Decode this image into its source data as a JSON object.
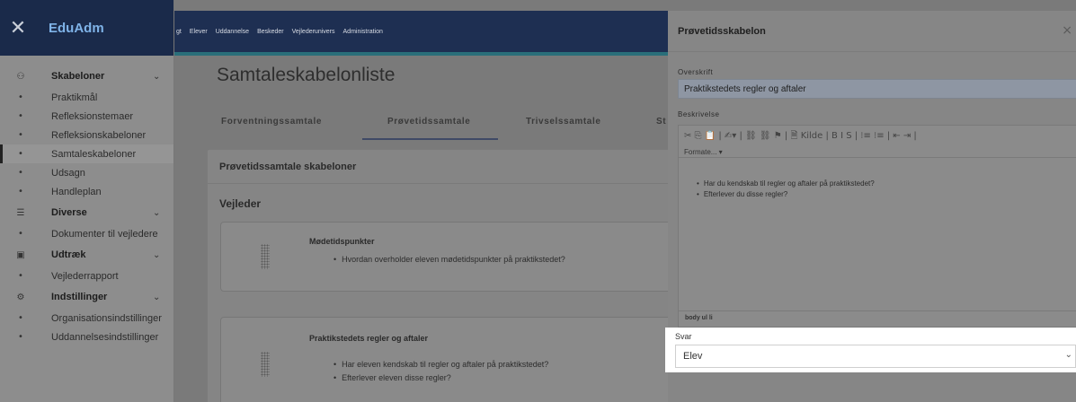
{
  "app": {
    "brand": "EduAdm",
    "close_icon": "close-icon"
  },
  "sidebar": {
    "rows": [
      {
        "kind": "group",
        "icon": "people-icon",
        "glyph": "⚇",
        "label": "Skabeloner",
        "chevron": "⌄"
      },
      {
        "kind": "item",
        "label": "Praktikmål"
      },
      {
        "kind": "item",
        "label": "Refleksionstemaer"
      },
      {
        "kind": "item",
        "label": "Refleksionskabeloner"
      },
      {
        "kind": "item",
        "label": "Samtaleskabeloner",
        "active": true
      },
      {
        "kind": "item",
        "label": "Udsagn"
      },
      {
        "kind": "item",
        "label": "Handleplan"
      },
      {
        "kind": "group",
        "icon": "list-icon",
        "glyph": "☰",
        "label": "Diverse",
        "chevron": "⌄"
      },
      {
        "kind": "item",
        "label": "Dokumenter til vejledere"
      },
      {
        "kind": "group",
        "icon": "export-icon",
        "glyph": "▣",
        "label": "Udtræk",
        "chevron": "⌄"
      },
      {
        "kind": "item",
        "label": "Vejlederrapport"
      },
      {
        "kind": "group",
        "icon": "settings-icon",
        "glyph": "⚙",
        "label": "Indstillinger",
        "chevron": "⌄"
      },
      {
        "kind": "item",
        "label": "Organisationsindstillinger"
      },
      {
        "kind": "item",
        "label": "Uddannelsesindstillinger"
      }
    ]
  },
  "topnav": {
    "items": [
      "gt",
      "Elever",
      "Uddannelse",
      "Beskeder",
      "Vejlederunivers",
      "Administration"
    ]
  },
  "main": {
    "title": "Samtaleskabelonliste",
    "tabs": [
      "Forventningssamtale",
      "Prøvetidssamtale",
      "Trivselssamtale",
      "St"
    ],
    "card_title": "Prøvetidssamtale skabeloner",
    "section": "Vejleder",
    "questions": [
      {
        "title": "Mødetidspunkter",
        "items": [
          "Hvordan overholder eleven mødetidspunkter på praktikstedet?"
        ]
      },
      {
        "title": "Praktikstedets regler og aftaler",
        "items": [
          "Har eleven kendskab til regler og aftaler på praktikstedet?",
          "Efterlever eleven disse regler?"
        ]
      }
    ]
  },
  "panel": {
    "title": "Prøvetidsskabelon",
    "close": "×",
    "overskrift_label": "Overskrift",
    "overskrift_value": "Praktikstedets regler og aftaler",
    "beskrivelse_label": "Beskrivelse",
    "toolbar_row1": "✂  ⎘  📋 | ✍▾ | ⛓ ⛓ ⚑ | 🗎 Kilde | B  I  S | ⁝≡ ⁝≡ | ⇤ ⇥ |",
    "format_label": "Formate...  ▾",
    "editor_items": [
      "Har du kendskab til regler og aftaler på praktikstedet?",
      "Efterlever du disse regler?"
    ],
    "footer_path": "body  ul  li",
    "svar_label": "Svar",
    "svar_value": "Elev",
    "svar_chevron": "⌄"
  }
}
